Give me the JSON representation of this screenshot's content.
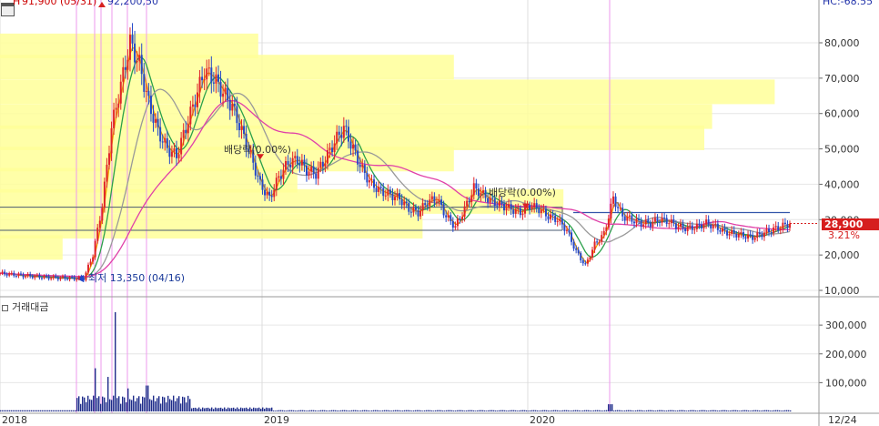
{
  "chart_data": {
    "type": "line",
    "subtype": "candlestick-with-volume-profile",
    "header_left": "91,900 (05/31)",
    "header_left_prefix": "H",
    "header_center": "92,200,50",
    "header_right": "HC:-68.55",
    "price_axis": {
      "min": 10000,
      "max": 90000,
      "ticks": [
        {
          "value": 80000,
          "label": "80,000"
        },
        {
          "value": 70000,
          "label": "70,000"
        },
        {
          "value": 60000,
          "label": "60,000"
        },
        {
          "value": 50000,
          "label": "50,000"
        },
        {
          "value": 40000,
          "label": "40,000"
        },
        {
          "value": 30000,
          "label": "30,000"
        },
        {
          "value": 20000,
          "label": "20,000"
        },
        {
          "value": 10000,
          "label": "10,000"
        }
      ]
    },
    "volume_axis": {
      "min": 0,
      "max": 370000,
      "ticks": [
        {
          "value": 300000,
          "label": "300,000"
        },
        {
          "value": 200000,
          "label": "200,000"
        },
        {
          "value": 100000,
          "label": "100,000"
        }
      ]
    },
    "date_labels": [
      "2018",
      "2019",
      "2020",
      "12/24"
    ],
    "current_price": {
      "value": 28900,
      "label": "28,900",
      "change": "3.21%"
    },
    "volume_panel_title": "거래대금",
    "annotations": [
      {
        "label": "최저 13,350 (04/16)",
        "price": 13350
      },
      {
        "label": "배당락(0.00%)",
        "price": 50000,
        "short_label": "배당락(0.00%)"
      },
      {
        "label": "배당락(0.00%)",
        "price": 35000
      }
    ],
    "volume_profile_price_levels": [
      79000,
      73000,
      66000,
      59000,
      53000,
      47000,
      41000,
      35000,
      28000,
      22000
    ],
    "volume_profile_relative": [
      0.33,
      0.58,
      0.99,
      0.91,
      0.9,
      0.58,
      0.38,
      0.72,
      0.54,
      0.08
    ],
    "close_series": [
      14800,
      14600,
      14300,
      14100,
      13900,
      13700,
      13600,
      13500,
      13400,
      13350,
      20000,
      34000,
      56000,
      68000,
      80000,
      74000,
      63000,
      55000,
      50000,
      48000,
      56000,
      64000,
      72000,
      70000,
      66000,
      62000,
      55000,
      48000,
      40000,
      36000,
      42000,
      46000,
      47000,
      44000,
      43000,
      47000,
      52000,
      56000,
      50000,
      44000,
      40000,
      38000,
      37000,
      36000,
      33000,
      32000,
      35000,
      36000,
      31000,
      28000,
      33000,
      39000,
      37000,
      35000,
      34000,
      33000,
      32000,
      34000,
      33000,
      31000,
      30000,
      27000,
      21000,
      17000,
      23000,
      26000,
      36000,
      31000,
      30000,
      29000,
      29000,
      30000,
      29500,
      28000,
      27500,
      28000,
      29000,
      28000,
      26500,
      26000,
      25500,
      25000,
      26000,
      27000,
      28000,
      28900
    ]
  }
}
